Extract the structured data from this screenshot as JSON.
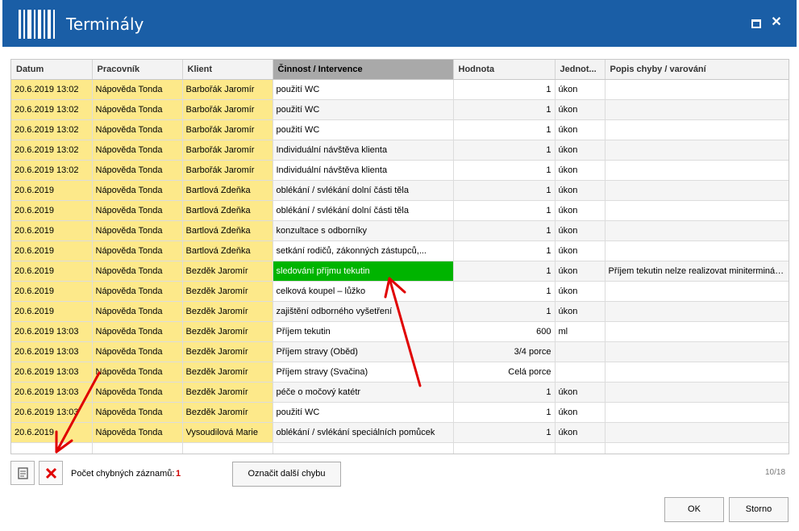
{
  "window": {
    "title": "Terminály"
  },
  "columns": [
    "Datum",
    "Pracovník",
    "Klient",
    "Činnost / Intervence",
    "Hodnota",
    "Jednot...",
    "Popis chyby / varování"
  ],
  "rows": [
    {
      "date": "20.6.2019 13:02",
      "worker": "Nápověda Tonda",
      "client": "Barbořák Jaromír",
      "activity": "použití WC",
      "value": "1",
      "unit": "úkon",
      "error": ""
    },
    {
      "date": "20.6.2019 13:02",
      "worker": "Nápověda Tonda",
      "client": "Barbořák Jaromír",
      "activity": "použití WC",
      "value": "1",
      "unit": "úkon",
      "error": ""
    },
    {
      "date": "20.6.2019 13:02",
      "worker": "Nápověda Tonda",
      "client": "Barbořák Jaromír",
      "activity": "použití WC",
      "value": "1",
      "unit": "úkon",
      "error": ""
    },
    {
      "date": "20.6.2019 13:02",
      "worker": "Nápověda Tonda",
      "client": "Barbořák Jaromír",
      "activity": "Individuální návštěva klienta",
      "value": "1",
      "unit": "úkon",
      "error": ""
    },
    {
      "date": "20.6.2019 13:02",
      "worker": "Nápověda Tonda",
      "client": "Barbořák Jaromír",
      "activity": "Individuální návštěva klienta",
      "value": "1",
      "unit": "úkon",
      "error": ""
    },
    {
      "date": "20.6.2019",
      "worker": "Nápověda Tonda",
      "client": "Bartlová Zdeňka",
      "activity": "oblékání / svlékání dolní části těla",
      "value": "1",
      "unit": "úkon",
      "error": ""
    },
    {
      "date": "20.6.2019",
      "worker": "Nápověda Tonda",
      "client": "Bartlová Zdeňka",
      "activity": "oblékání / svlékání dolní části těla",
      "value": "1",
      "unit": "úkon",
      "error": ""
    },
    {
      "date": "20.6.2019",
      "worker": "Nápověda Tonda",
      "client": "Bartlová Zdeňka",
      "activity": "konzultace s odborníky",
      "value": "1",
      "unit": "úkon",
      "error": ""
    },
    {
      "date": "20.6.2019",
      "worker": "Nápověda Tonda",
      "client": "Bartlová Zdeňka",
      "activity": "setkání rodičů, zákonných zástupců,...",
      "value": "1",
      "unit": "úkon",
      "error": ""
    },
    {
      "date": "20.6.2019",
      "worker": "Nápověda Tonda",
      "client": "Bezděk Jaromír",
      "activity": "sledování příjmu tekutin",
      "value": "1",
      "unit": "úkon",
      "error": "Příjem tekutin nelze realizovat miniterminálem!"
    },
    {
      "date": "20.6.2019",
      "worker": "Nápověda Tonda",
      "client": "Bezděk Jaromír",
      "activity": "celková koupel – lůžko",
      "value": "1",
      "unit": "úkon",
      "error": ""
    },
    {
      "date": "20.6.2019",
      "worker": "Nápověda Tonda",
      "client": "Bezděk Jaromír",
      "activity": "zajištění odborného vyšetření",
      "value": "1",
      "unit": "úkon",
      "error": ""
    },
    {
      "date": "20.6.2019 13:03",
      "worker": "Nápověda Tonda",
      "client": "Bezděk Jaromír",
      "activity": "Příjem tekutin",
      "value": "600",
      "unit": "ml",
      "error": ""
    },
    {
      "date": "20.6.2019 13:03",
      "worker": "Nápověda Tonda",
      "client": "Bezděk Jaromír",
      "activity": "Příjem stravy (Oběd)",
      "value": "3/4 porce",
      "unit": "",
      "error": ""
    },
    {
      "date": "20.6.2019 13:03",
      "worker": "Nápověda Tonda",
      "client": "Bezděk Jaromír",
      "activity": "Příjem stravy (Svačina)",
      "value": "Celá porce",
      "unit": "",
      "error": ""
    },
    {
      "date": "20.6.2019 13:03",
      "worker": "Nápověda Tonda",
      "client": "Bezděk Jaromír",
      "activity": "péče o močový katétr",
      "value": "1",
      "unit": "úkon",
      "error": ""
    },
    {
      "date": "20.6.2019 13:03",
      "worker": "Nápověda Tonda",
      "client": "Bezděk Jaromír",
      "activity": "použití WC",
      "value": "1",
      "unit": "úkon",
      "error": ""
    },
    {
      "date": "20.6.2019",
      "worker": "Nápověda Tonda",
      "client": "Vysoudilová Marie",
      "activity": "oblékání / svlékání speciálních pomůcek",
      "value": "1",
      "unit": "úkon",
      "error": ""
    }
  ],
  "highlight_row": 9,
  "footer": {
    "error_count_label": "Počet chybných záznamů:",
    "error_count": "1",
    "mark_next_button": "Označit další chybu",
    "pager": "10/18",
    "ok_button": "OK",
    "cancel_button": "Storno"
  },
  "colors": {
    "titlebar": "#1a5ea6",
    "highlight": "#00b400",
    "yellow": "#fde98a",
    "arrow": "#e00000",
    "error_count": "#d00000"
  }
}
